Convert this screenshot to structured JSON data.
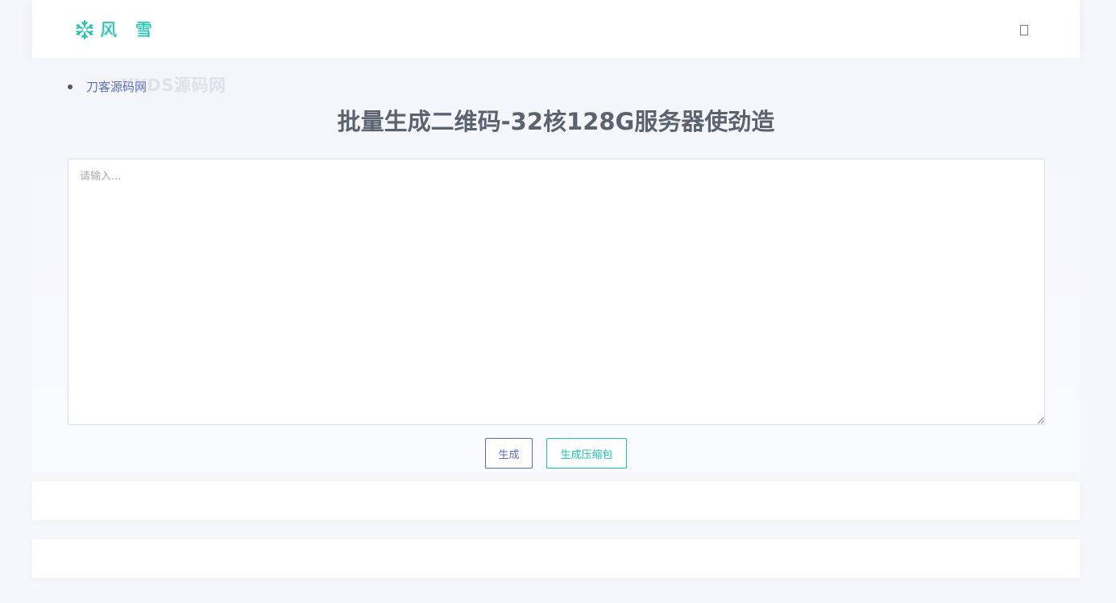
{
  "header": {
    "logo_text": "风 雪",
    "logo_icon": "snowflake-icon",
    "menu_icon": "menu-icon"
  },
  "breadcrumb": {
    "link_label": "刀客源码网"
  },
  "watermark": {
    "text": "XYDS源码网"
  },
  "main": {
    "title": "批量生成二维码-32核128G服务器使劲造",
    "input": {
      "placeholder": "请输入...",
      "value": ""
    },
    "buttons": {
      "generate_label": "生成",
      "zip_label": "生成压缩包"
    }
  },
  "colors": {
    "accent_blue": "#5a6bc4",
    "accent_teal": "#1cc4b0",
    "title_gray": "#5b6270",
    "page_background": "#f6f7fb"
  }
}
